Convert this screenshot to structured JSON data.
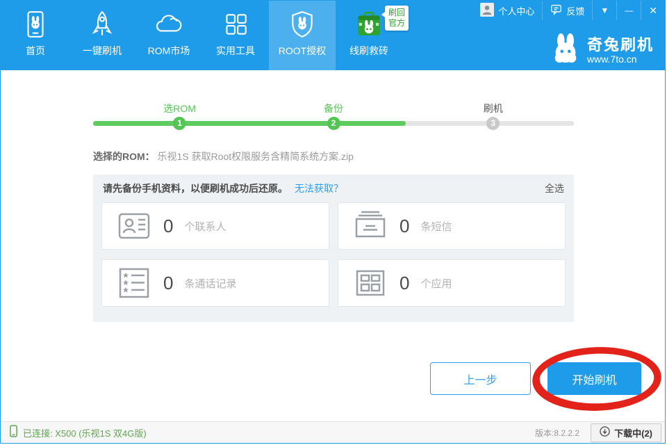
{
  "colors": {
    "accent_blue": "#1f9ce9",
    "active_tab_blue": "#4db0ee",
    "progress_green": "#53c553",
    "link_blue": "#2d9ff0",
    "status_green": "#61a551",
    "annotation_red": "#e3231a"
  },
  "icons": {
    "dropdown": "▼",
    "minimize": "—",
    "close": "✕"
  },
  "header": {
    "nav": [
      {
        "label": "首页",
        "icon": "phone-rabbit-icon",
        "active": false
      },
      {
        "label": "一键刷机",
        "icon": "rocket-icon",
        "active": false
      },
      {
        "label": "ROM市场",
        "icon": "cloud-icon",
        "active": false
      },
      {
        "label": "实用工具",
        "icon": "grid-icon",
        "active": false
      },
      {
        "label": "ROOT授权",
        "icon": "shield-rabbit-icon",
        "active": true
      },
      {
        "label": "线刷救砖",
        "icon": "green-box-rabbit-icon",
        "active": false,
        "badge_line1": "刷回",
        "badge_line2": "官方"
      }
    ],
    "user_center": "个人中心",
    "feedback": "反馈",
    "brand": {
      "name": "奇兔刷机",
      "url": "www.7to.cn"
    }
  },
  "steps": {
    "progress_percent": 65,
    "items": [
      {
        "label": "选ROM",
        "number": "1",
        "state": "done"
      },
      {
        "label": "备份",
        "number": "2",
        "state": "active"
      },
      {
        "label": "刷机",
        "number": "3",
        "state": "pending"
      }
    ]
  },
  "rom": {
    "caption": "选择的ROM：",
    "value": "乐视1S 获取Root权限服务含精简系统方案.zip"
  },
  "backup": {
    "title": "请先备份手机资料，以便刷机成功后还原。",
    "link": "无法获取？",
    "select_all": "全选",
    "items": [
      {
        "count": "0",
        "label": "个联系人",
        "icon": "contacts-icon"
      },
      {
        "count": "0",
        "label": "条短信",
        "icon": "sms-icon"
      },
      {
        "count": "0",
        "label": "条通话记录",
        "icon": "call-log-icon"
      },
      {
        "count": "0",
        "label": "个应用",
        "icon": "apps-icon"
      }
    ]
  },
  "actions": {
    "back": "上一步",
    "start": "开始刷机"
  },
  "statusbar": {
    "connected": "已连接: X500 (乐视1S 双4G版)",
    "version": "版本:8.2.2.2",
    "download": "下载中(2)"
  }
}
